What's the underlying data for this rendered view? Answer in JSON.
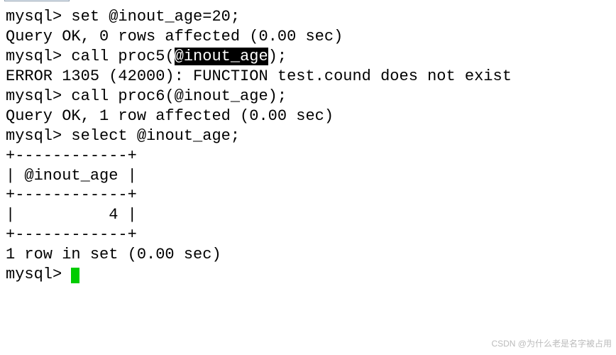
{
  "term": {
    "prompt": "mysql>",
    "lines": {
      "set_cmd": "set @inout_age=20;",
      "set_result": "Query OK, 0 rows affected (0.00 sec)",
      "blank": "",
      "call5_pre": "call proc5(",
      "call5_sel": "@inout_age",
      "call5_post": ");",
      "call5_err": "ERROR 1305 (42000): FUNCTION test.cound does not exist",
      "call6_cmd": "call proc6(@inout_age);",
      "call6_result": "Query OK, 1 row affected (0.00 sec)",
      "select_cmd": "select @inout_age;",
      "tbl_border": "+------------+",
      "tbl_header": "| @inout_age |",
      "tbl_value": "|          4 |",
      "select_result": "1 row in set (0.00 sec)"
    }
  },
  "watermark": "CSDN @为什么老是名字被占用"
}
